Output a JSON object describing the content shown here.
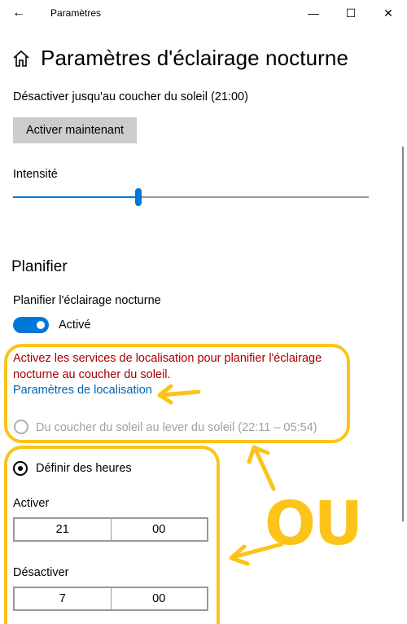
{
  "window": {
    "back_glyph": "←",
    "title": "Paramètres",
    "minimize": "—",
    "maximize": "☐",
    "close": "✕"
  },
  "header": {
    "title": "Paramètres d'éclairage nocturne"
  },
  "status": {
    "text": "Désactiver jusqu'au coucher du soleil (21:00)"
  },
  "activate_button": {
    "label": "Activer maintenant"
  },
  "intensity": {
    "label": "Intensité",
    "value_fraction": 0.35
  },
  "schedule": {
    "section_title": "Planifier",
    "toggle_label": "Planifier l'éclairage nocturne",
    "toggle_state": "Activé",
    "warning": "Activez les services de localisation pour planifier l'éclairage nocturne au coucher du soleil.",
    "location_link": "Paramètres de localisation",
    "option_sunset": "Du coucher du soleil au lever du soleil (22:11 – 05:54)",
    "option_custom": "Définir des heures",
    "on_label": "Activer",
    "on_hour": "21",
    "on_minute": "00",
    "off_label": "Désactiver",
    "off_hour": "7",
    "off_minute": "00"
  },
  "annotation": {
    "ou_text": "OU",
    "color": "#fcc419"
  },
  "colors": {
    "accent": "#0078d7",
    "warning": "#a80000",
    "link": "#0063b1"
  }
}
